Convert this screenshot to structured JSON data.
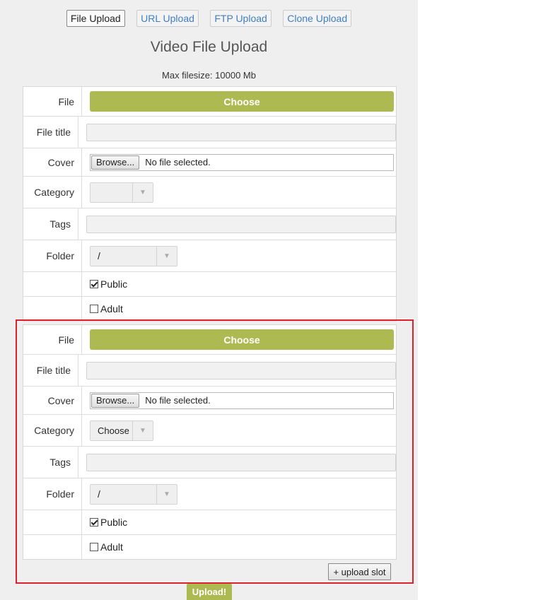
{
  "tabs": [
    {
      "label": "File Upload",
      "active": true
    },
    {
      "label": "URL Upload",
      "active": false
    },
    {
      "label": "FTP Upload",
      "active": false
    },
    {
      "label": "Clone Upload",
      "active": false
    }
  ],
  "page_title": "Video File Upload",
  "max_filesize": "Max filesize: 10000 Mb",
  "labels": {
    "file": "File",
    "file_title": "File title",
    "cover": "Cover",
    "category": "Category",
    "tags": "Tags",
    "folder": "Folder"
  },
  "slots": [
    {
      "choose_label": "Choose",
      "file_title_value": "",
      "browse_label": "Browse...",
      "cover_status": "No file selected.",
      "category_value": "",
      "tags_value": "",
      "folder_value": "/",
      "public_label": "Public",
      "public_checked": true,
      "adult_label": "Adult",
      "adult_checked": false
    },
    {
      "choose_label": "Choose",
      "file_title_value": "",
      "browse_label": "Browse...",
      "cover_status": "No file selected.",
      "category_value": "Choose",
      "tags_value": "",
      "folder_value": "/",
      "public_label": "Public",
      "public_checked": true,
      "adult_label": "Adult",
      "adult_checked": false
    }
  ],
  "add_slot_label": "+ upload slot",
  "upload_label": "Upload!",
  "colors": {
    "accent": "#adba52",
    "highlight": "#e0202a",
    "tab_link": "#3f7fc4"
  }
}
